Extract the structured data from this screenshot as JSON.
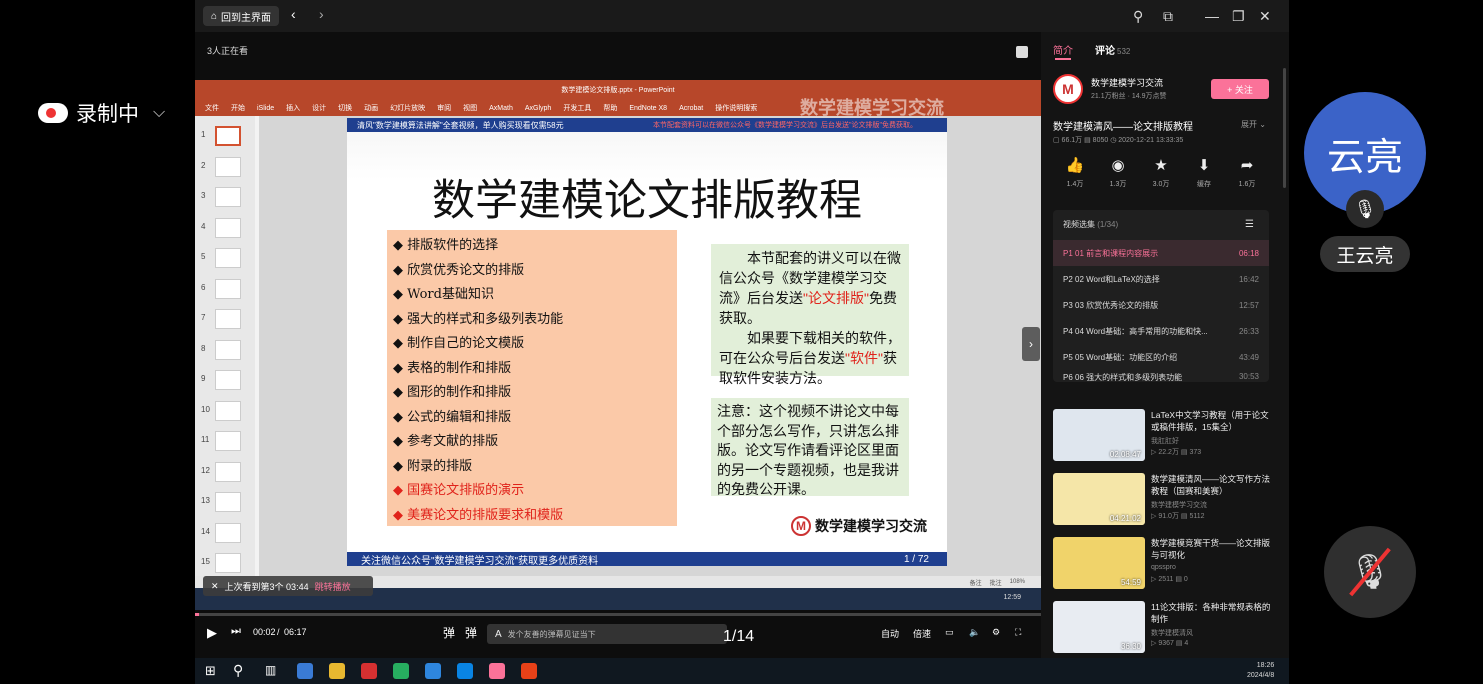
{
  "overlay": {
    "recording_label": "录制中",
    "participant_avatar_text": "云亮",
    "participant_name": "王云亮"
  },
  "titlebar": {
    "home_label": "回到主界面"
  },
  "player": {
    "viewer_count": "3人正在看",
    "resume_text": "上次看到第3个 03:44",
    "resume_jump": "跳转播放",
    "time_current": "00:02",
    "time_total": "06:17",
    "danmaku_placeholder": "发个友善的弹幕见证当下",
    "page_counter": "1/14",
    "auto_label": "自动",
    "speed_label": "倍速",
    "progress": 0.005
  },
  "ppt": {
    "window_title": "数学建模论文排版.pptx - PowerPoint",
    "menu": [
      "文件",
      "开始",
      "iSlide",
      "插入",
      "设计",
      "切换",
      "动画",
      "幻灯片放映",
      "审阅",
      "视图",
      "AxMath",
      "AxGlyph",
      "开发工具",
      "帮助",
      "EndNote X8",
      "Acrobat",
      "操作说明搜索"
    ],
    "watermark": "数学建模学习交流",
    "thumb_numbers": [
      "1",
      "2",
      "3",
      "4",
      "5",
      "6",
      "7",
      "8",
      "9",
      "10",
      "11",
      "12",
      "13",
      "14",
      "15"
    ],
    "status_items": [
      "备注",
      "批注",
      "108%"
    ],
    "slide": {
      "banner_left": "清风\"数学建模算法讲解\"全套视频，单人购买现看仅需58元",
      "banner_right": "本节配套资料可以在微信公众号《数学建模学习交流》后台发送\"论文排版\"免费获取。",
      "title": "数学建模论文排版教程",
      "bullets": [
        "◆ 排版软件的选择",
        "◆ 欣赏优秀论文的排版",
        "◆ Word基础知识",
        "◆ 强大的样式和多级列表功能",
        "◆ 制作自己的论文模版",
        "◆ 表格的制作和排版",
        "◆ 图形的制作和排版",
        "◆ 公式的编辑和排版",
        "◆ 参考文献的排版",
        "◆ 附录的排版"
      ],
      "bullets_red": [
        "◆ 国赛论文排版的演示",
        "◆ 美赛论文的排版要求和模版"
      ],
      "box1_p1a": "本节配套的讲义可以在微信公众号《数学建模学习交流》后台发送",
      "box1_p1_red": "\"论文排版\"",
      "box1_p1b": "免费获取。",
      "box1_p2a": "如果要下载相关的软件，可在公众号后台发送",
      "box1_p2_red": "\"软件\"",
      "box1_p2b": "获取软件安装方法。",
      "box2": "注意：这个视频不讲论文中每个部分怎么写作，只讲怎么排版。论文写作请看评论区里面的另一个专题视频，也是我讲的免费公开课。",
      "logo_text": "数学建模学习交流",
      "banner_bottom": "关注微信公众号\"数学建模学习交流\"获取更多优质资料",
      "page_num": "1 / 72"
    }
  },
  "sidebar": {
    "tab_intro": "简介",
    "tab_comment": "评论",
    "comment_count": "532",
    "uploader_name": "数学建模学习交流",
    "uploader_stats": "21.1万粉丝 · 14.9万点赞",
    "follow_label": "+ 关注",
    "video_title": "数学建模清风——论文排版教程",
    "expand_label": "展开 ⌄",
    "video_meta": "▢ 66.1万  ▤ 8050  ◷ 2020-12-21 13:33:35",
    "actions": [
      {
        "icon": "👍",
        "count": "1.4万"
      },
      {
        "icon": "◉",
        "count": "1.3万"
      },
      {
        "icon": "★",
        "count": "3.0万"
      },
      {
        "icon": "⬇",
        "count": "缓存"
      },
      {
        "icon": "➦",
        "count": "1.6万"
      }
    ],
    "playlist_title": "视频选集",
    "playlist_count": "(1/34)",
    "episodes": [
      {
        "title": "P1  01 前言和课程内容展示",
        "duration": "06:18"
      },
      {
        "title": "P2  02 Word和LaTeX的选择",
        "duration": "16:42"
      },
      {
        "title": "P3  03 欣赏优秀论文的排版",
        "duration": "12:57"
      },
      {
        "title": "P4  04 Word基础：高手常用的功能和快...",
        "duration": "26:33"
      },
      {
        "title": "P5  05 Word基础：功能区的介绍",
        "duration": "43:49"
      },
      {
        "title": "P6  06 强大的样式和多级列表功能",
        "duration": "30:53"
      }
    ],
    "recommendations": [
      {
        "title": "LaTeX中文学习教程（用于论文或稿件排版，15集全）",
        "uploader": "我肛肛好",
        "stats": "▷ 22.2万  ▤ 373",
        "duration": "02:08:47"
      },
      {
        "title": "数学建模清风——论文写作方法教程（国赛和美赛）",
        "uploader": "数学建模学习交流",
        "stats": "▷ 91.0万  ▤ 5112",
        "duration": "04:21:02"
      },
      {
        "title": "数学建模竞赛干货——论文排版与可视化",
        "uploader": "qpsspro",
        "stats": "▷ 2511  ▤ 0",
        "duration": "54:59"
      },
      {
        "title": "11论文排版：各种非常规表格的制作",
        "uploader": "数学建模清风",
        "stats": "▷ 9367  ▤ 4",
        "duration": "36:30"
      }
    ]
  },
  "os": {
    "time": "18:26",
    "date": "2024/4/8",
    "inner_time": "12:59"
  }
}
